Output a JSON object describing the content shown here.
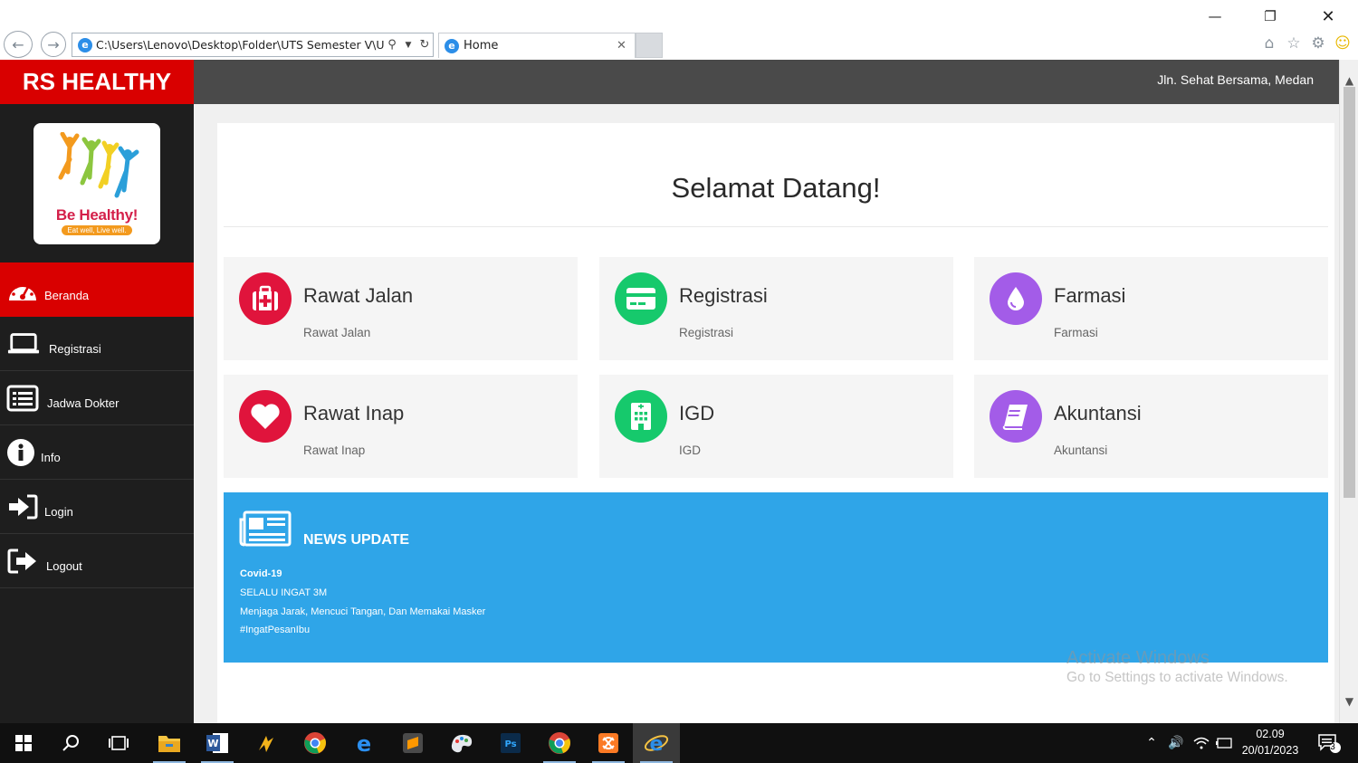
{
  "browser": {
    "url": "C:\\Users\\Lenovo\\Desktop\\Folder\\UTS Semester V\\UTS",
    "tab_title": "Home"
  },
  "sidebar": {
    "brand": "RS HEALTHY",
    "logo": {
      "main": "Be Healthy!",
      "sub": "Eat well, Live well."
    },
    "items": [
      {
        "label": "Beranda",
        "icon": "dashboard-icon",
        "active": true
      },
      {
        "label": "Registrasi",
        "icon": "laptop-icon",
        "active": false
      },
      {
        "label": "Jadwa Dokter",
        "icon": "list-icon",
        "active": false
      },
      {
        "label": "Info",
        "icon": "info-icon",
        "active": false
      },
      {
        "label": "Login",
        "icon": "sign-in-icon",
        "active": false
      },
      {
        "label": "Logout",
        "icon": "sign-out-icon",
        "active": false
      }
    ]
  },
  "topbar": {
    "address": "Jln. Sehat Bersama, Medan"
  },
  "main": {
    "welcome": "Selamat Datang!",
    "cards": [
      {
        "title": "Rawat Jalan",
        "subtitle": "Rawat Jalan",
        "icon": "medkit-icon",
        "color": "#e0143c"
      },
      {
        "title": "Registrasi",
        "subtitle": "Registrasi",
        "icon": "credit-card-icon",
        "color": "#16c96c"
      },
      {
        "title": "Farmasi",
        "subtitle": "Farmasi",
        "icon": "tint-icon",
        "color": "#a35ce8"
      },
      {
        "title": "Rawat Inap",
        "subtitle": "Rawat Inap",
        "icon": "heart-icon",
        "color": "#e0143c"
      },
      {
        "title": "IGD",
        "subtitle": "IGD",
        "icon": "hospital-icon",
        "color": "#16c96c"
      },
      {
        "title": "Akuntansi",
        "subtitle": "Akuntansi",
        "icon": "book-icon",
        "color": "#a35ce8"
      }
    ],
    "news": {
      "title": "NEWS UPDATE",
      "lines": [
        "Covid-19",
        "SELALU INGAT 3M",
        "Menjaga Jarak, Mencuci Tangan, Dan Memakai Masker",
        "#IngatPesanIbu"
      ],
      "color": "#2fa5e8"
    }
  },
  "watermark": {
    "line1": "Activate Windows",
    "line2": "Go to Settings to activate Windows."
  },
  "taskbar": {
    "time": "02.09",
    "date": "20/01/2023",
    "notification_count": "3"
  },
  "colors": {
    "brand_red": "#d90000",
    "sidebar_bg": "#1e1e1e",
    "topbar_bg": "#4a4a4a"
  }
}
